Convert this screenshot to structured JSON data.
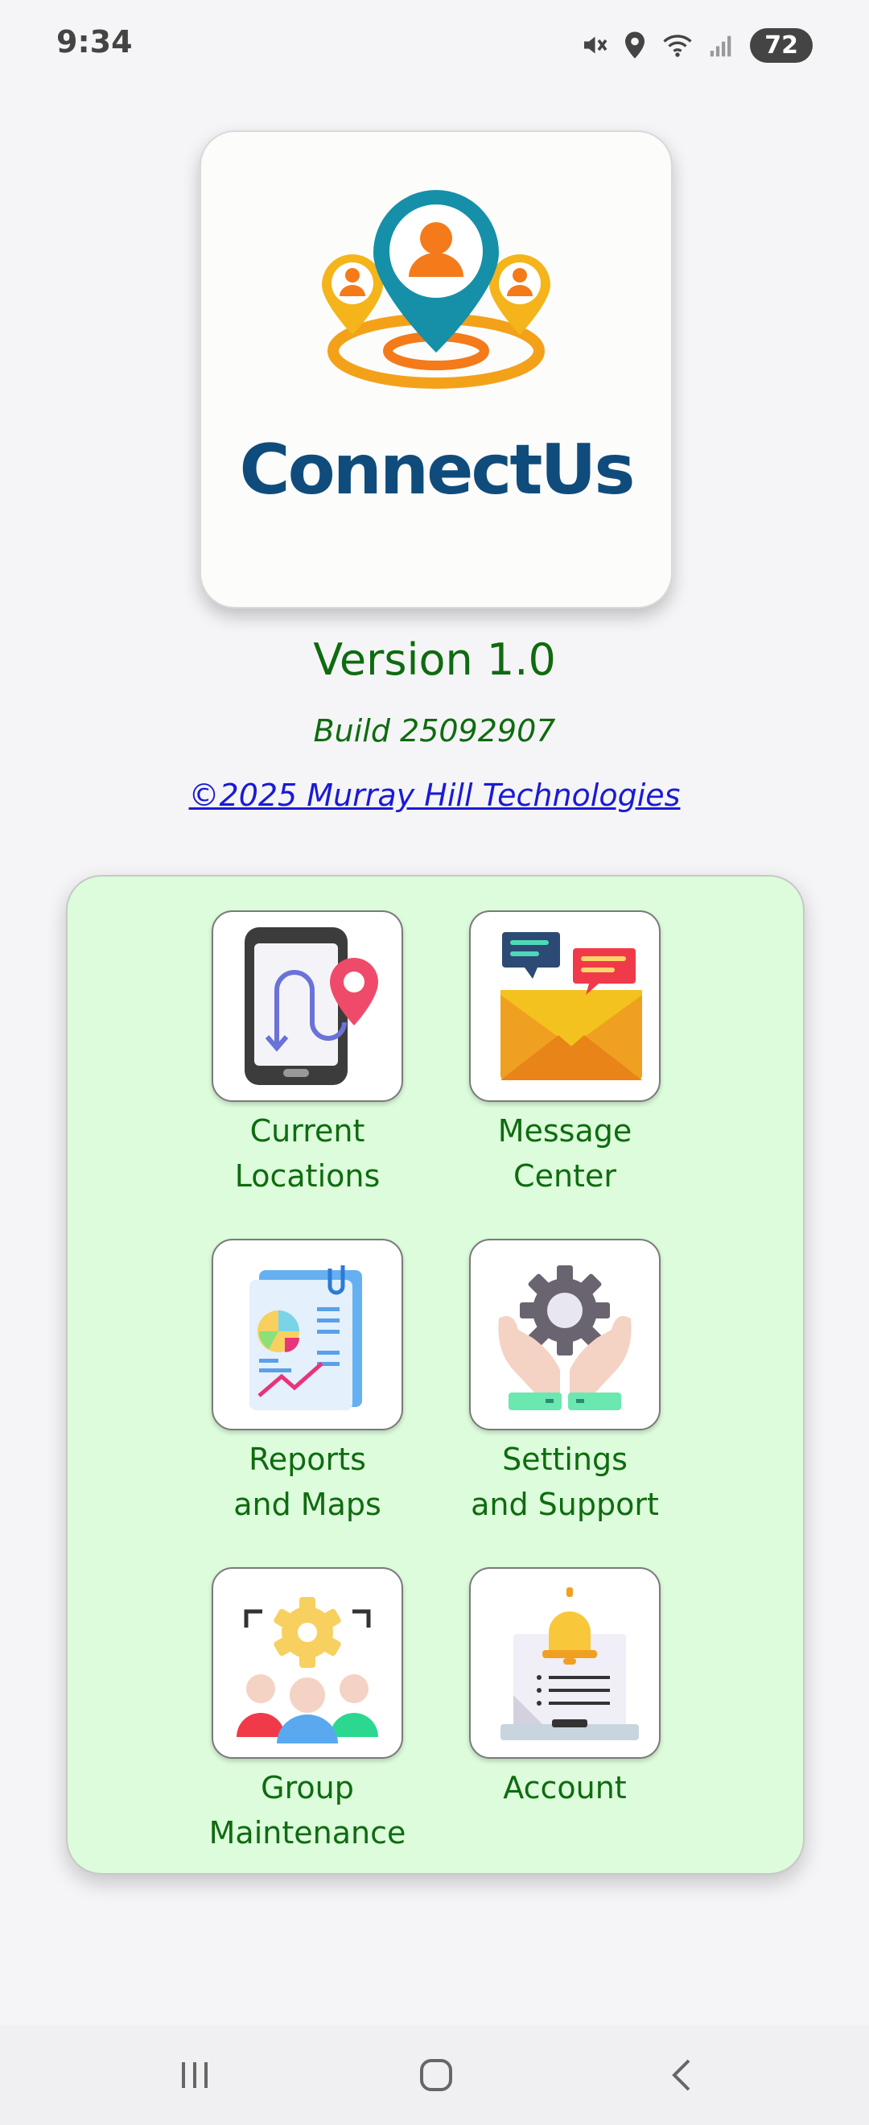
{
  "status_bar": {
    "time": "9:34",
    "battery": "72",
    "icons": [
      "mute-icon",
      "location-icon",
      "wifi-icon",
      "signal-icon"
    ]
  },
  "logo": {
    "app_name": "ConnectUs",
    "colors": {
      "pin_teal": "#1590a8",
      "pin_orange": "#f4a11a",
      "person_orange": "#f47a1a",
      "text_navy": "#0f4c7c"
    }
  },
  "about": {
    "version": "Version 1.0",
    "build": "Build 25092907",
    "copyright": "©2025 Murray Hill Technologies"
  },
  "menu": {
    "items": [
      {
        "id": "current-locations",
        "line1": "Current",
        "line2": "Locations",
        "icon": "phone-location-icon"
      },
      {
        "id": "message-center",
        "line1": "Message",
        "line2": "Center",
        "icon": "envelope-chat-icon"
      },
      {
        "id": "reports-and-maps",
        "line1": "Reports",
        "line2": "and Maps",
        "icon": "report-chart-icon"
      },
      {
        "id": "settings-and-support",
        "line1": "Settings",
        "line2": "and Support",
        "icon": "gear-hands-icon"
      },
      {
        "id": "group-maintenance",
        "line1": "Group",
        "line2": "Maintenance",
        "icon": "group-gear-icon"
      },
      {
        "id": "account",
        "line1": "Account",
        "line2": "",
        "icon": "laptop-bell-icon"
      }
    ]
  },
  "nav_bar": {
    "buttons": [
      "recent-apps-icon",
      "home-icon",
      "back-icon"
    ]
  }
}
